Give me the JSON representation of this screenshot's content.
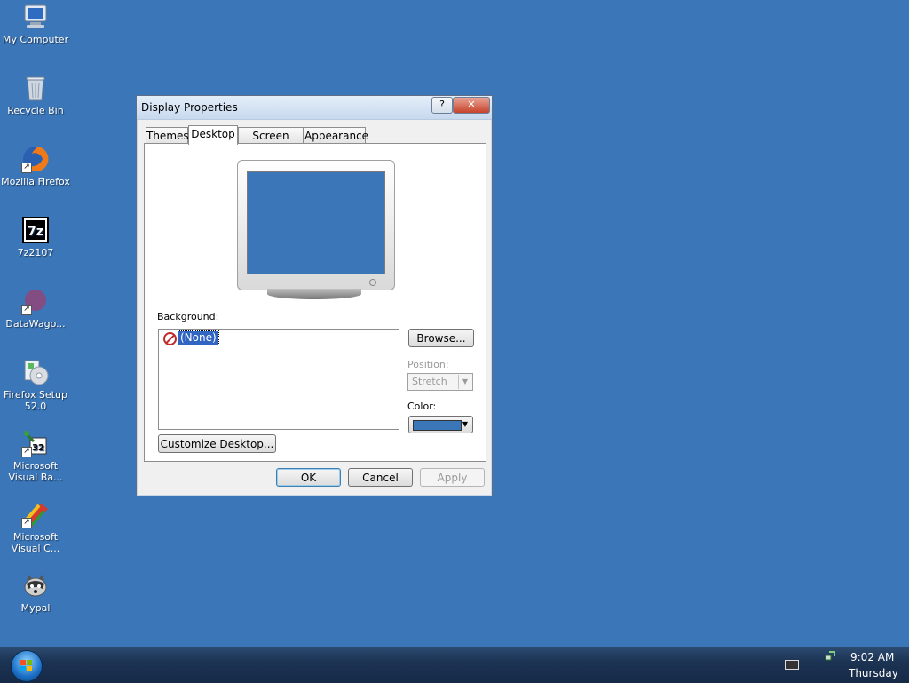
{
  "desktop": {
    "icons": [
      {
        "label": "My Computer",
        "icon": "my-computer-icon"
      },
      {
        "label": "Recycle Bin",
        "icon": "recycle-bin-icon"
      },
      {
        "label": "Mozilla Firefox",
        "icon": "firefox-icon"
      },
      {
        "label": "7z2107",
        "icon": "7zip-icon"
      },
      {
        "label": "DataWago...",
        "icon": "datawagon-icon"
      },
      {
        "label": "Firefox Setup 52.0",
        "icon": "firefox-setup-icon"
      },
      {
        "label": "Microsoft Visual Ba...",
        "icon": "visual-basic-icon"
      },
      {
        "label": "Microsoft Visual C...",
        "icon": "visual-cpp-icon"
      },
      {
        "label": "Mypal",
        "icon": "mypal-icon"
      }
    ]
  },
  "dialog": {
    "title": "Display Properties",
    "help_label": "?",
    "close_label": "✕",
    "tabs": [
      {
        "label": "Themes"
      },
      {
        "label": "Desktop"
      },
      {
        "label": "Screen Saver"
      },
      {
        "label": "Appearance"
      }
    ],
    "active_tab": "Desktop",
    "background_label": "Background:",
    "background_items": [
      {
        "label": "(None)",
        "selected": true
      }
    ],
    "browse_label": "Browse...",
    "position_label": "Position:",
    "position_value": "Stretch",
    "color_label": "Color:",
    "color_value": "#3b77b8",
    "customize_label": "Customize Desktop...",
    "ok_label": "OK",
    "cancel_label": "Cancel",
    "apply_label": "Apply"
  },
  "taskbar": {
    "time": "9:02 AM",
    "day": "Thursday"
  }
}
